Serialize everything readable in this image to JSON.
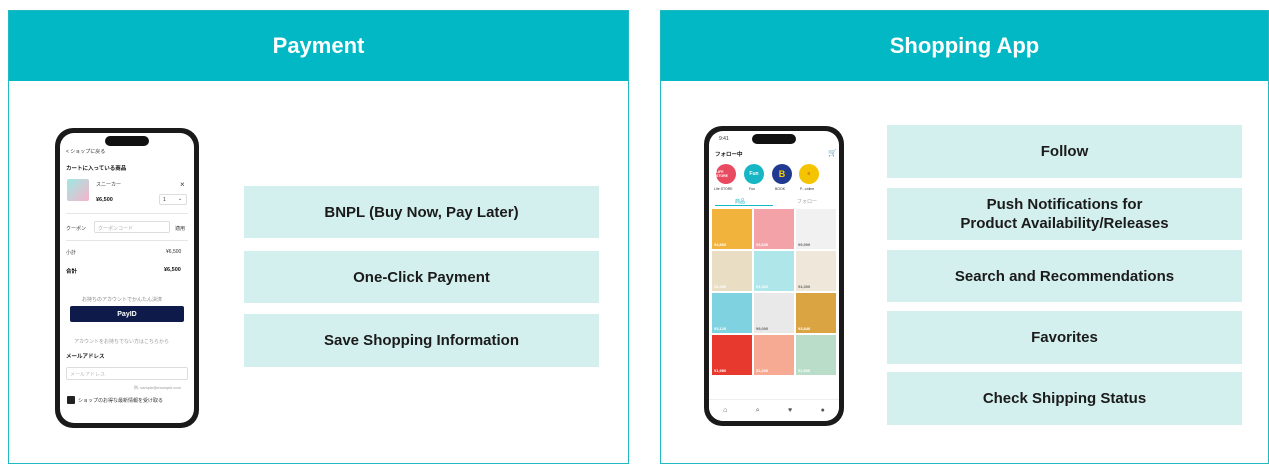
{
  "payment": {
    "title": "Payment",
    "features": [
      "BNPL (Buy Now, Pay Later)",
      "One-Click Payment",
      "Save Shopping Information"
    ],
    "phone": {
      "back": "< ショップに戻る",
      "cart_title": "カートに入っている商品",
      "item_name": "スニーカー",
      "item_price": "¥6,500",
      "qty": "1",
      "coupon_label": "クーポン",
      "coupon_placeholder": "クーポンコード",
      "coupon_apply": "適用",
      "subtotal_label": "小計",
      "subtotal_value": "¥6,500",
      "total_label": "合計",
      "total_value": "¥6,500",
      "payid_caption": "お持ちのアカウントでかんたん決済",
      "payid_label": "PayID",
      "divider_text": "アカウントをお持ちでない方はこちらから",
      "email_label": "メールアドレス",
      "email_placeholder": "メールアドレス",
      "email_hint": "例: sample@example.com",
      "checkbox_label": "ショップのお得な最新情報を受け取る"
    }
  },
  "shopping": {
    "title": "Shopping App",
    "features": [
      "Follow",
      "Push Notifications for\nProduct Availability/Releases",
      "Search and Recommendations",
      "Favorites",
      "Check Shipping Status"
    ],
    "phone": {
      "time": "9:41",
      "header": "フォロー中",
      "stores": [
        {
          "label": "LIFE STORE",
          "caption": "Life STORE",
          "color": "#e84a5f",
          "fg": "#ffffff"
        },
        {
          "label": "Fun",
          "caption": "Fun",
          "color": "#17b6c4",
          "fg": "#ffffff"
        },
        {
          "label": "B",
          "caption": "BOOK",
          "color": "#1f3a8f",
          "fg": "#f5d000"
        },
        {
          "label": "≡",
          "caption": "P...online",
          "color": "#f5c400",
          "fg": "#c0392b"
        }
      ],
      "tab_products": "商品",
      "tab_following": "フォロー",
      "prices": [
        "¥4,800",
        "¥3,620",
        "¥9,900",
        "¥4,200",
        "¥1,520",
        "¥4,300",
        "¥3,120",
        "¥9,000",
        "¥3,840",
        "¥1,980",
        "¥2,200",
        "¥1,500"
      ],
      "tiles": [
        "#f2b33d",
        "#f3a3a7",
        "#f1f1f1",
        "#e9ddc4",
        "#aee6ea",
        "#efe7da",
        "#7fd3e0",
        "#e9e9e9",
        "#d9a441",
        "#e8392f",
        "#f6a993",
        "#b9ddc9"
      ]
    }
  }
}
